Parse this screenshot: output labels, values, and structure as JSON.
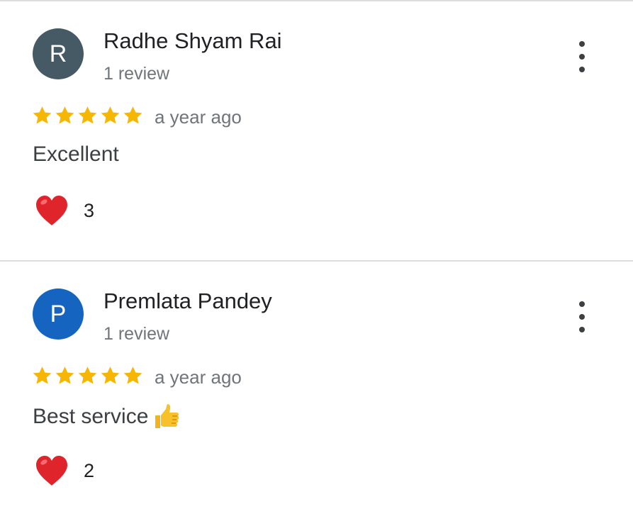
{
  "reviews": [
    {
      "avatar_letter": "R",
      "avatar_color": "#455a64",
      "name": "Radhe Shyam Rai",
      "meta": "1 review",
      "rating": 5,
      "time": "a year ago",
      "text": "Excellent",
      "has_thumbs_up_emoji": false,
      "likes": "3"
    },
    {
      "avatar_letter": "P",
      "avatar_color": "#1565c0",
      "name": "Premlata Pandey",
      "meta": "1 review",
      "rating": 5,
      "time": "a year ago",
      "text": "Best service",
      "has_thumbs_up_emoji": true,
      "likes": "2"
    }
  ],
  "colors": {
    "star": "#f6b704",
    "heart": "#e0242b",
    "divider": "#dadce0"
  },
  "icons": {
    "menu": "more-vert-icon",
    "star": "star-icon",
    "like": "heart-icon",
    "thumb": "thumbs-up-icon"
  }
}
